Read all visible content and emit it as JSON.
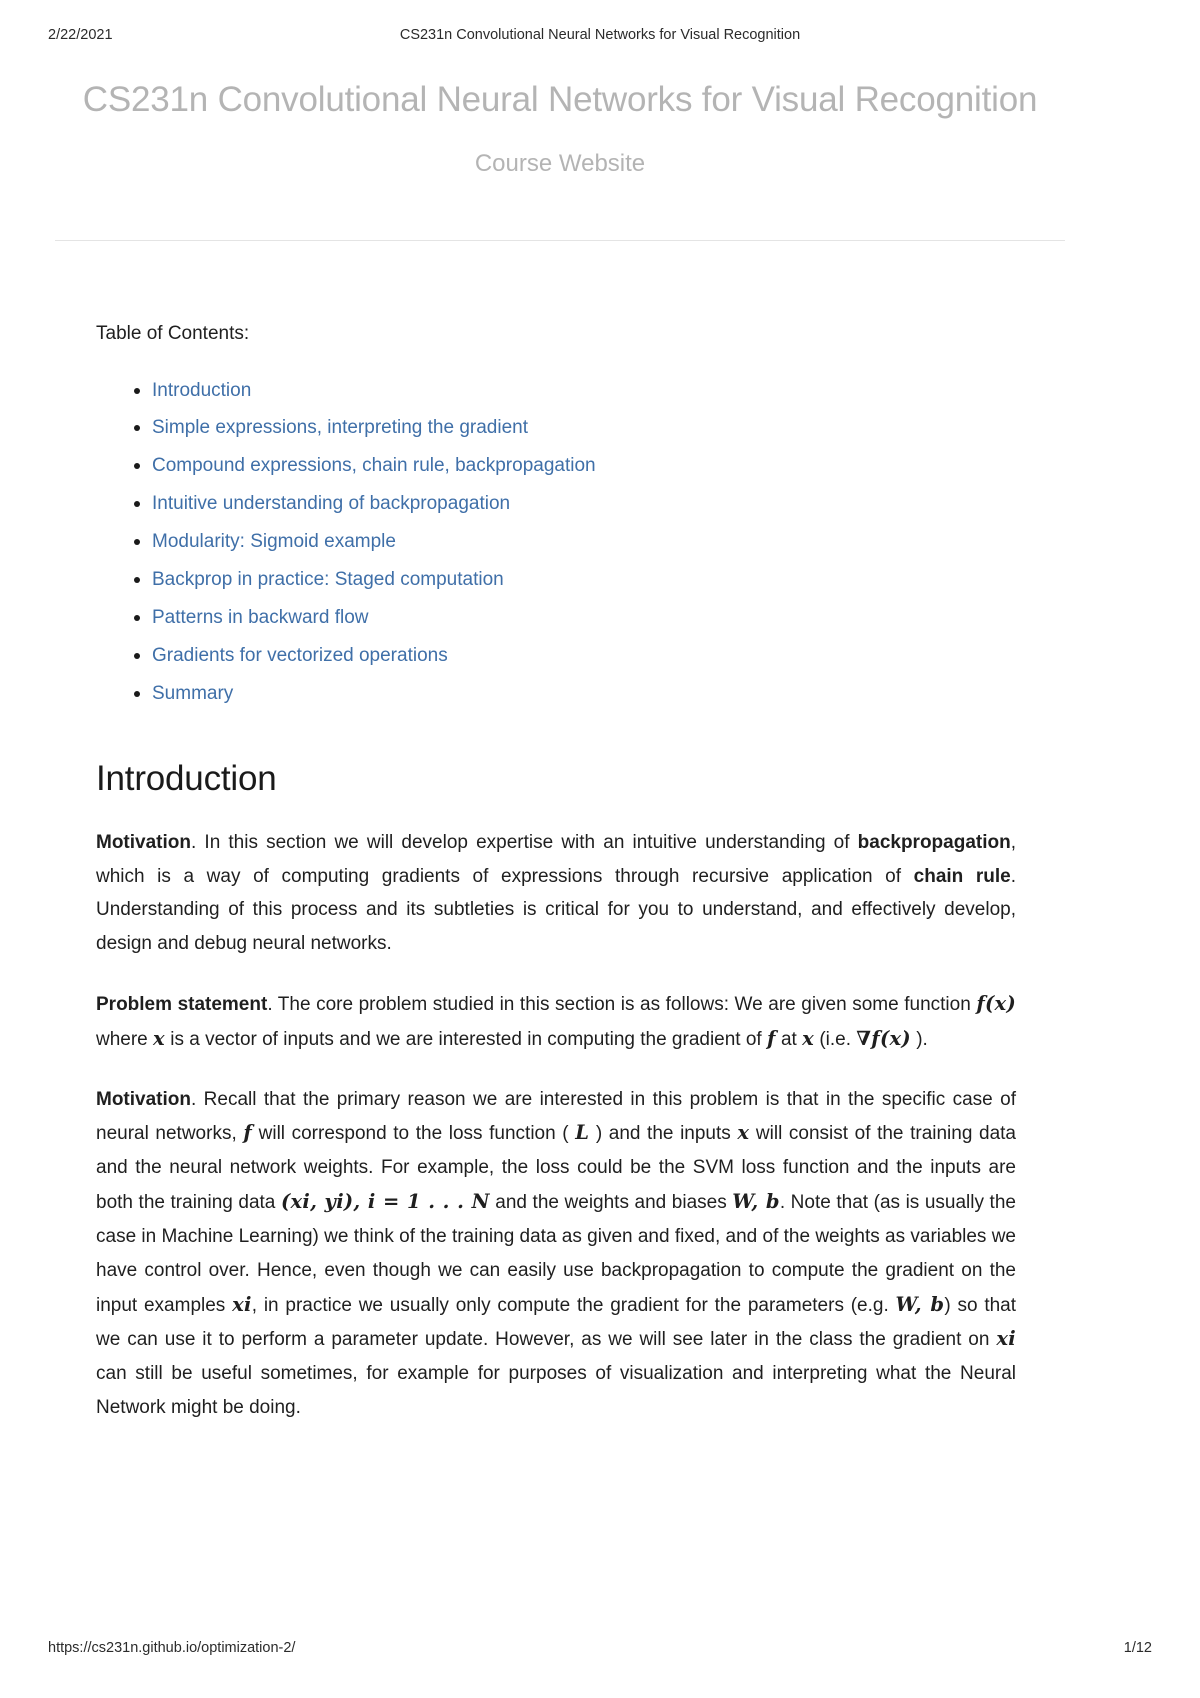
{
  "print_header": {
    "date": "2/22/2021",
    "title": "CS231n Convolutional Neural Networks for Visual Recognition"
  },
  "print_footer": {
    "url": "https://cs231n.github.io/optimization-2/",
    "page": "1/12"
  },
  "masthead": {
    "site_title": "CS231n Convolutional Neural Networks for Visual Recognition",
    "site_subtitle": "Course Website"
  },
  "toc": {
    "label": "Table of Contents:",
    "items": [
      {
        "label": "Introduction"
      },
      {
        "label": "Simple expressions, interpreting the gradient"
      },
      {
        "label": "Compound expressions, chain rule, backpropagation"
      },
      {
        "label": "Intuitive understanding of backpropagation"
      },
      {
        "label": "Modularity: Sigmoid example"
      },
      {
        "label": "Backprop in practice: Staged computation"
      },
      {
        "label": "Patterns in backward flow"
      },
      {
        "label": "Gradients for vectorized operations"
      },
      {
        "label": "Summary"
      }
    ]
  },
  "section": {
    "heading": "Introduction",
    "paragraphs": {
      "motivation1": {
        "lead": "Motivation",
        "t1": ". In this section we will develop expertise with an intuitive understanding of ",
        "b2": "backpropagation",
        "t2": ", which is a way of computing gradients of expressions through recursive application of ",
        "b3": "chain rule",
        "t3": ". Understanding of this process and its subtleties is critical for you to understand, and effectively develop, design and debug neural networks."
      },
      "problem_statement": {
        "lead": "Problem statement",
        "t1": ". The core problem studied in this section is as follows: We are given some function ",
        "m1": "f(x)",
        "t2": " where ",
        "m2": "x",
        "t3": " is a vector of inputs and we are interested in computing the gradient of ",
        "m3": "f",
        "t4": " at ",
        "m4": "x",
        "t5": " (i.e. ",
        "m5": "∇f(x)",
        "t6": " )."
      },
      "motivation2": {
        "lead": "Motivation",
        "t1": ". Recall that the primary reason we are interested in this problem is that in the specific case of neural networks, ",
        "m1": "f",
        "t2": " will correspond to the loss function ( ",
        "m2": "L",
        "t3": " ) and the inputs ",
        "m3": "x",
        "t4": " will consist of the training data and the neural network weights. For example, the loss could be the SVM loss function and the inputs are both the training data ",
        "m4": "(xi, yi), i = 1 . . . N",
        "t5": " and the weights and biases ",
        "m5": "W, b",
        "t6": ". Note that (as is usually the case in Machine Learning) we think of the training data as given and fixed, and of the weights as variables we have control over. Hence, even though we can easily use backpropagation to compute the gradient on the input examples ",
        "m6": "xi",
        "t7": ", in practice we usually only compute the gradient for the parameters (e.g. ",
        "m7": "W, b",
        "t8": ") so that we can use it to perform a parameter update. However, as we will see later in the class the gradient on ",
        "m8": "xi",
        "t9": " can still be useful sometimes, for example for purposes of visualization and interpreting what the Neural Network might be doing."
      }
    }
  },
  "colors": {
    "link": "#3f6fa8",
    "masthead_gray": "#b4b4b4",
    "text": "#1f1f1f"
  }
}
